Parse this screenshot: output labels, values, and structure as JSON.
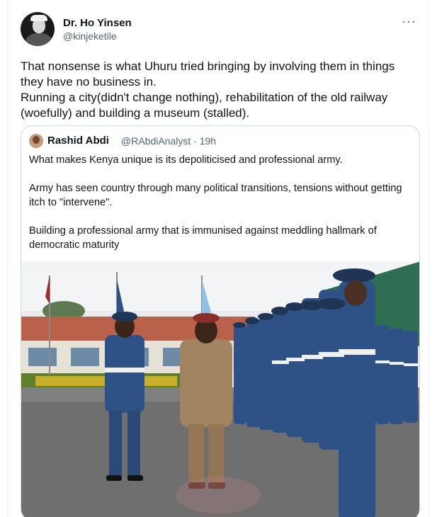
{
  "tweet": {
    "author_name": "Dr. Ho Yinsen",
    "author_handle": "@kinjeketile",
    "more_glyph": "···",
    "text_lines": [
      "That nonsense is what Uhuru tried bringing by involving them in things",
      "they have no business in.",
      "Running a city(didn't change nothing), rehabilitation of the old railway",
      "(woefully) and building a museum (stalled)."
    ]
  },
  "quoted_tweet": {
    "author_name": "Rashid Abdi",
    "meta": "@RAbdiAnalyst · 19h",
    "paragraphs": [
      "What makes Kenya unique is its depoliticised and professional army.",
      "Army has seen country through many political transitions, tensions without getting itch to \"intervene\".",
      "Building a professional army that is immunised against meddling hallmark of democratic maturity"
    ],
    "image_alt": "Military officers inspecting a guard of honour of uniformed airmen in blue"
  },
  "colors": {
    "text_primary": "#0f1419",
    "text_secondary": "#536471",
    "border": "#cfd9de",
    "uniform_blue": "#2f5286",
    "khaki": "#a38461"
  }
}
